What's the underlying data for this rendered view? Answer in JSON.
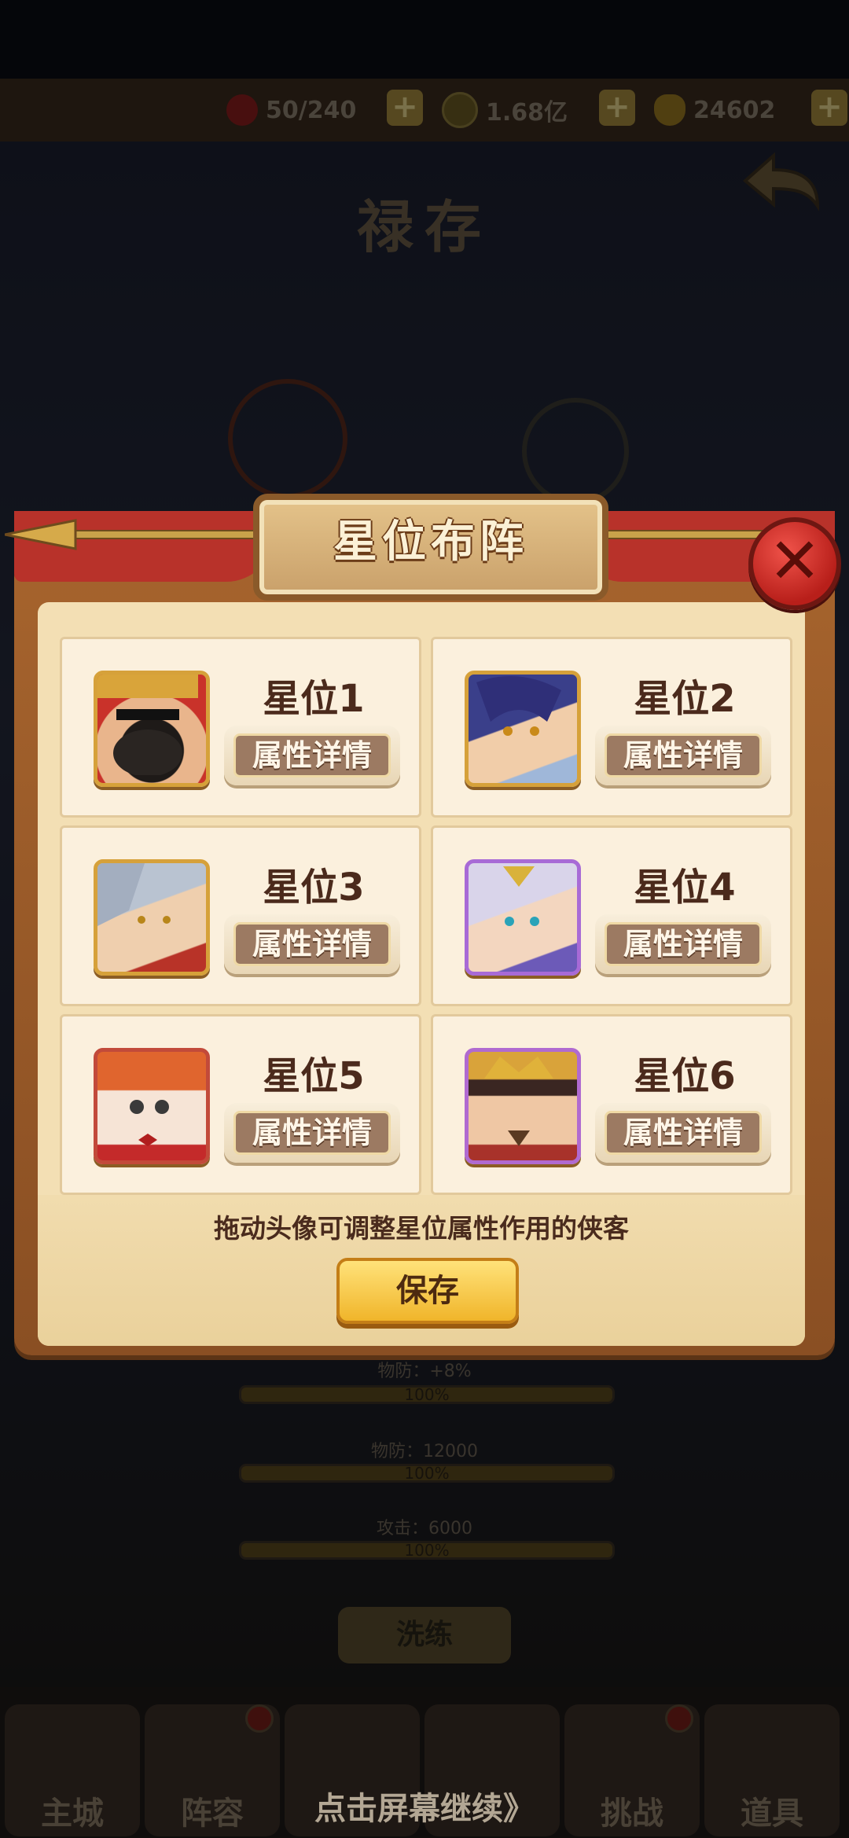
{
  "topbar": {
    "stamina": "50/240",
    "coins": "1.68亿",
    "gold": "24602",
    "stamina_icon": "red-gem-icon",
    "coin_icon": "copper-coin-icon",
    "gold_icon": "gold-ingot-icon"
  },
  "background": {
    "title": "禄存",
    "stats": [
      {
        "text": "物防：+8%",
        "bar": "100%"
      },
      {
        "text": "物防：12000",
        "bar": "100%"
      },
      {
        "text": "攻击：6000",
        "bar": "100%"
      }
    ],
    "refine_button": "洗练"
  },
  "dialog": {
    "title": "星位布阵",
    "slots": [
      {
        "label": "星位1",
        "button": "属性详情",
        "avatar": "bearded-general-avatar"
      },
      {
        "label": "星位2",
        "button": "属性详情",
        "avatar": "blue-haired-hero-avatar"
      },
      {
        "label": "星位3",
        "button": "属性详情",
        "avatar": "silver-haired-warrior-avatar"
      },
      {
        "label": "星位4",
        "button": "属性详情",
        "avatar": "white-haired-mage-avatar"
      },
      {
        "label": "星位5",
        "button": "属性详情",
        "avatar": "orange-haired-girl-avatar"
      },
      {
        "label": "星位6",
        "button": "属性详情",
        "avatar": "crowned-lord-avatar"
      }
    ],
    "hint": "拖动头像可调整星位属性作用的侠客",
    "save_button": "保存"
  },
  "bottom_nav": {
    "items": [
      "主城",
      "阵容",
      "",
      "",
      "挑战",
      "道具"
    ]
  },
  "continue_text": "点击屏幕继续》"
}
